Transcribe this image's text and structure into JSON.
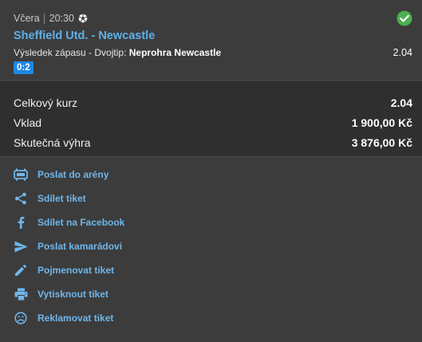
{
  "bet": {
    "day": "Včera",
    "time": "20:30",
    "match": "Sheffield Utd. - Newcastle",
    "market": "Výsledek zápasu - Dvojtip: ",
    "pick": "Neprohra Newcastle",
    "odds": "2.04",
    "score": "0:2",
    "status_icon": "check-circle-icon",
    "sport_icon": "soccer-ball-icon"
  },
  "summary": {
    "rows": [
      {
        "label": "Celkový kurz",
        "value": "2.04"
      },
      {
        "label": "Vklad",
        "value": "1 900,00 Kč"
      },
      {
        "label": "Skutečná výhra",
        "value": "3 876,00 Kč"
      }
    ]
  },
  "actions": [
    {
      "label": "Poslat do arény",
      "icon": "arena-icon"
    },
    {
      "label": "Sdílet tiket",
      "icon": "share-icon"
    },
    {
      "label": "Sdílet na Facebook",
      "icon": "facebook-icon"
    },
    {
      "label": "Poslat kamarádovi",
      "icon": "send-icon"
    },
    {
      "label": "Pojmenovat tiket",
      "icon": "pencil-icon"
    },
    {
      "label": "Vytisknout tiket",
      "icon": "print-icon"
    },
    {
      "label": "Reklamovat tiket",
      "icon": "sad-face-icon"
    }
  ],
  "colors": {
    "link": "#6fb6ea",
    "match": "#5eb0e8",
    "success": "#4caf50",
    "score_badge": "#1e88e5"
  }
}
